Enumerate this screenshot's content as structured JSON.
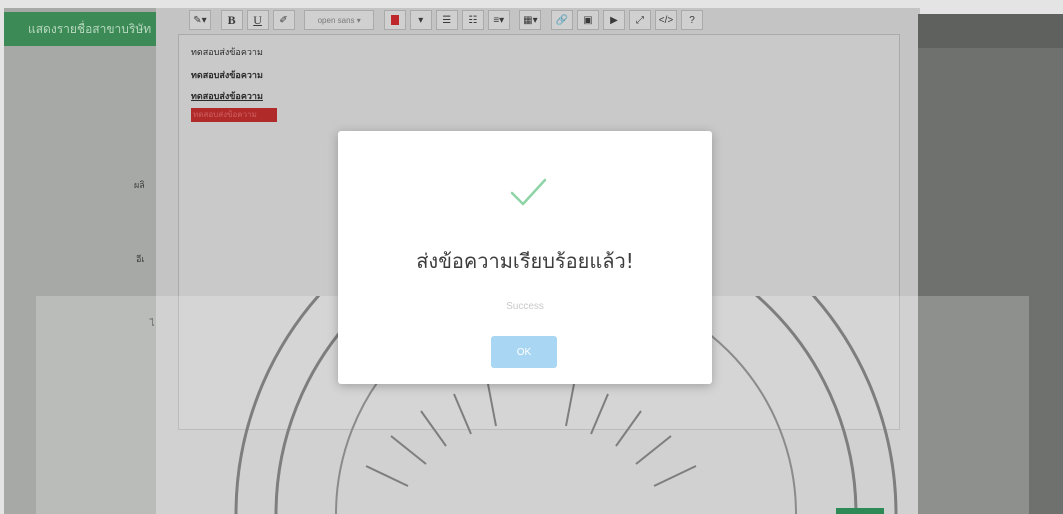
{
  "sidebar": {
    "header": "แสดงรายชื่อสาขาบริษัท",
    "labels": [
      "ผลิ",
      "อีเ",
      "ไ"
    ]
  },
  "toolbar": {
    "style_label": "✎▾",
    "bold_label": "B",
    "underline_label": "U",
    "eraser_label": "✐",
    "font_label": "open sans ▾",
    "color_dropdown_label": "▾",
    "ul_label": "☰",
    "ol_label": "☷",
    "align_label": "≡▾",
    "table_label": "▦▾",
    "link_label": "🔗",
    "image_label": "▣",
    "video_label": "▶",
    "fullscreen_label": "⤢",
    "code_label": "</>",
    "help_label": "?"
  },
  "editor": {
    "lines": [
      "ทดสอบส่งข้อความ",
      "ทดสอบส่งข้อความ",
      "ทดสอบส่งข้อความ",
      "ทดสอบส่งข้อความ"
    ]
  },
  "modal": {
    "icon": "check-icon",
    "title": "ส่งข้อความเรียบร้อยแล้ว!",
    "text": "Success",
    "ok_label": "OK"
  },
  "colors": {
    "accent_green": "#3c8a55",
    "swatch_red": "#c0272d",
    "ok_button": "#a9d6f2",
    "check": "#8ed4a6"
  }
}
